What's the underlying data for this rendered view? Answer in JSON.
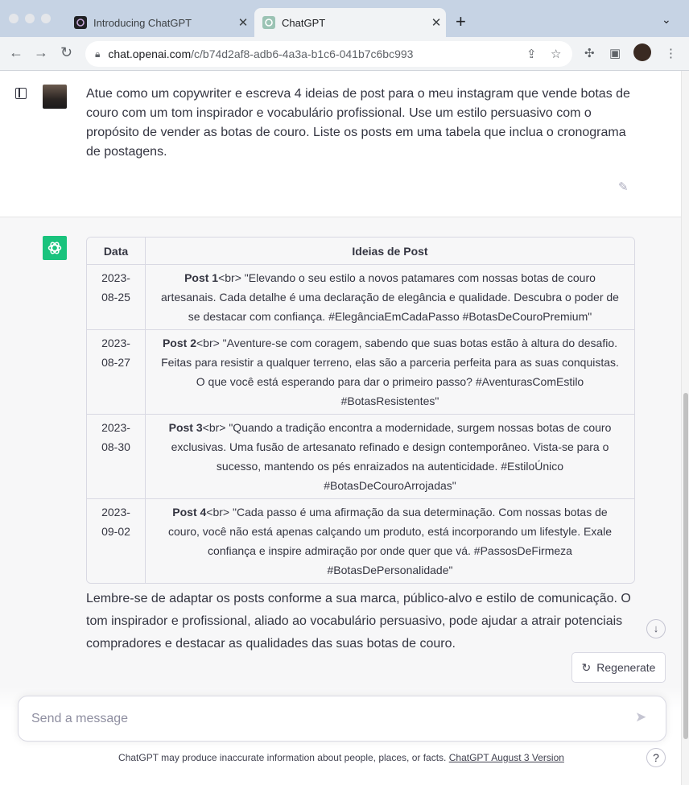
{
  "browser": {
    "tabs": [
      {
        "title": "Introducing ChatGPT",
        "close": "✕"
      },
      {
        "title": "ChatGPT",
        "close": "✕"
      }
    ],
    "new_tab": "+",
    "url_host": "chat.openai.com",
    "url_path": "/c/b74d2af8-adb6-4a3a-b1c6-041b7c6bc993"
  },
  "conversation": {
    "user_message": "Atue como um copywriter e escreva 4 ideias de post para o meu instagram que vende botas de couro com um tom inspirador e vocabulário profissional. Use um estilo persuasivo com o propósito de vender as botas de couro. Liste os posts em uma tabela que inclua o cronograma de postagens.",
    "table": {
      "headers": [
        "Data",
        "Ideias de Post"
      ],
      "rows": [
        {
          "date": "2023-08-25",
          "post_label": "Post 1",
          "text": "<br> \"Elevando o seu estilo a novos patamares com nossas botas de couro artesanais. Cada detalhe é uma declaração de elegância e qualidade. Descubra o poder de se destacar com confiança. #ElegânciaEmCadaPasso #BotasDeCouroPremium\""
        },
        {
          "date": "2023-08-27",
          "post_label": "Post 2",
          "text": "<br> \"Aventure-se com coragem, sabendo que suas botas estão à altura do desafio. Feitas para resistir a qualquer terreno, elas são a parceria perfeita para as suas conquistas. O que você está esperando para dar o primeiro passo? #AventurasComEstilo #BotasResistentes\""
        },
        {
          "date": "2023-08-30",
          "post_label": "Post 3",
          "text": "<br> \"Quando a tradição encontra a modernidade, surgem nossas botas de couro exclusivas. Uma fusão de artesanato refinado e design contemporâneo. Vista-se para o sucesso, mantendo os pés enraizados na autenticidade. #EstiloÚnico #BotasDeCouroArrojadas\""
        },
        {
          "date": "2023-09-02",
          "post_label": "Post 4",
          "text": "<br> \"Cada passo é uma afirmação da sua determinação. Com nossas botas de couro, você não está apenas calçando um produto, está incorporando um lifestyle. Exale confiança e inspire admiração por onde quer que vá. #PassosDeFirmeza #BotasDePersonalidade\""
        }
      ]
    },
    "closing_message": "Lembre-se de adaptar os posts conforme a sua marca, público-alvo e estilo de comunicação. O tom inspirador e profissional, aliado ao vocabulário persuasivo, pode ajudar a atrair potenciais compradores e destacar as qualidades das suas botas de couro."
  },
  "actions": {
    "regenerate_label": "Regenerate"
  },
  "composer": {
    "placeholder": "Send a message"
  },
  "footer": {
    "disclaimer": "ChatGPT may produce inaccurate information about people, places, or facts.",
    "version_link": "ChatGPT August 3 Version",
    "help": "?"
  },
  "icons": {
    "close": "close-icon",
    "regenerate": "refresh-icon",
    "send": "send-icon",
    "scroll_down": "arrow-down-icon",
    "edit": "edit-icon"
  }
}
